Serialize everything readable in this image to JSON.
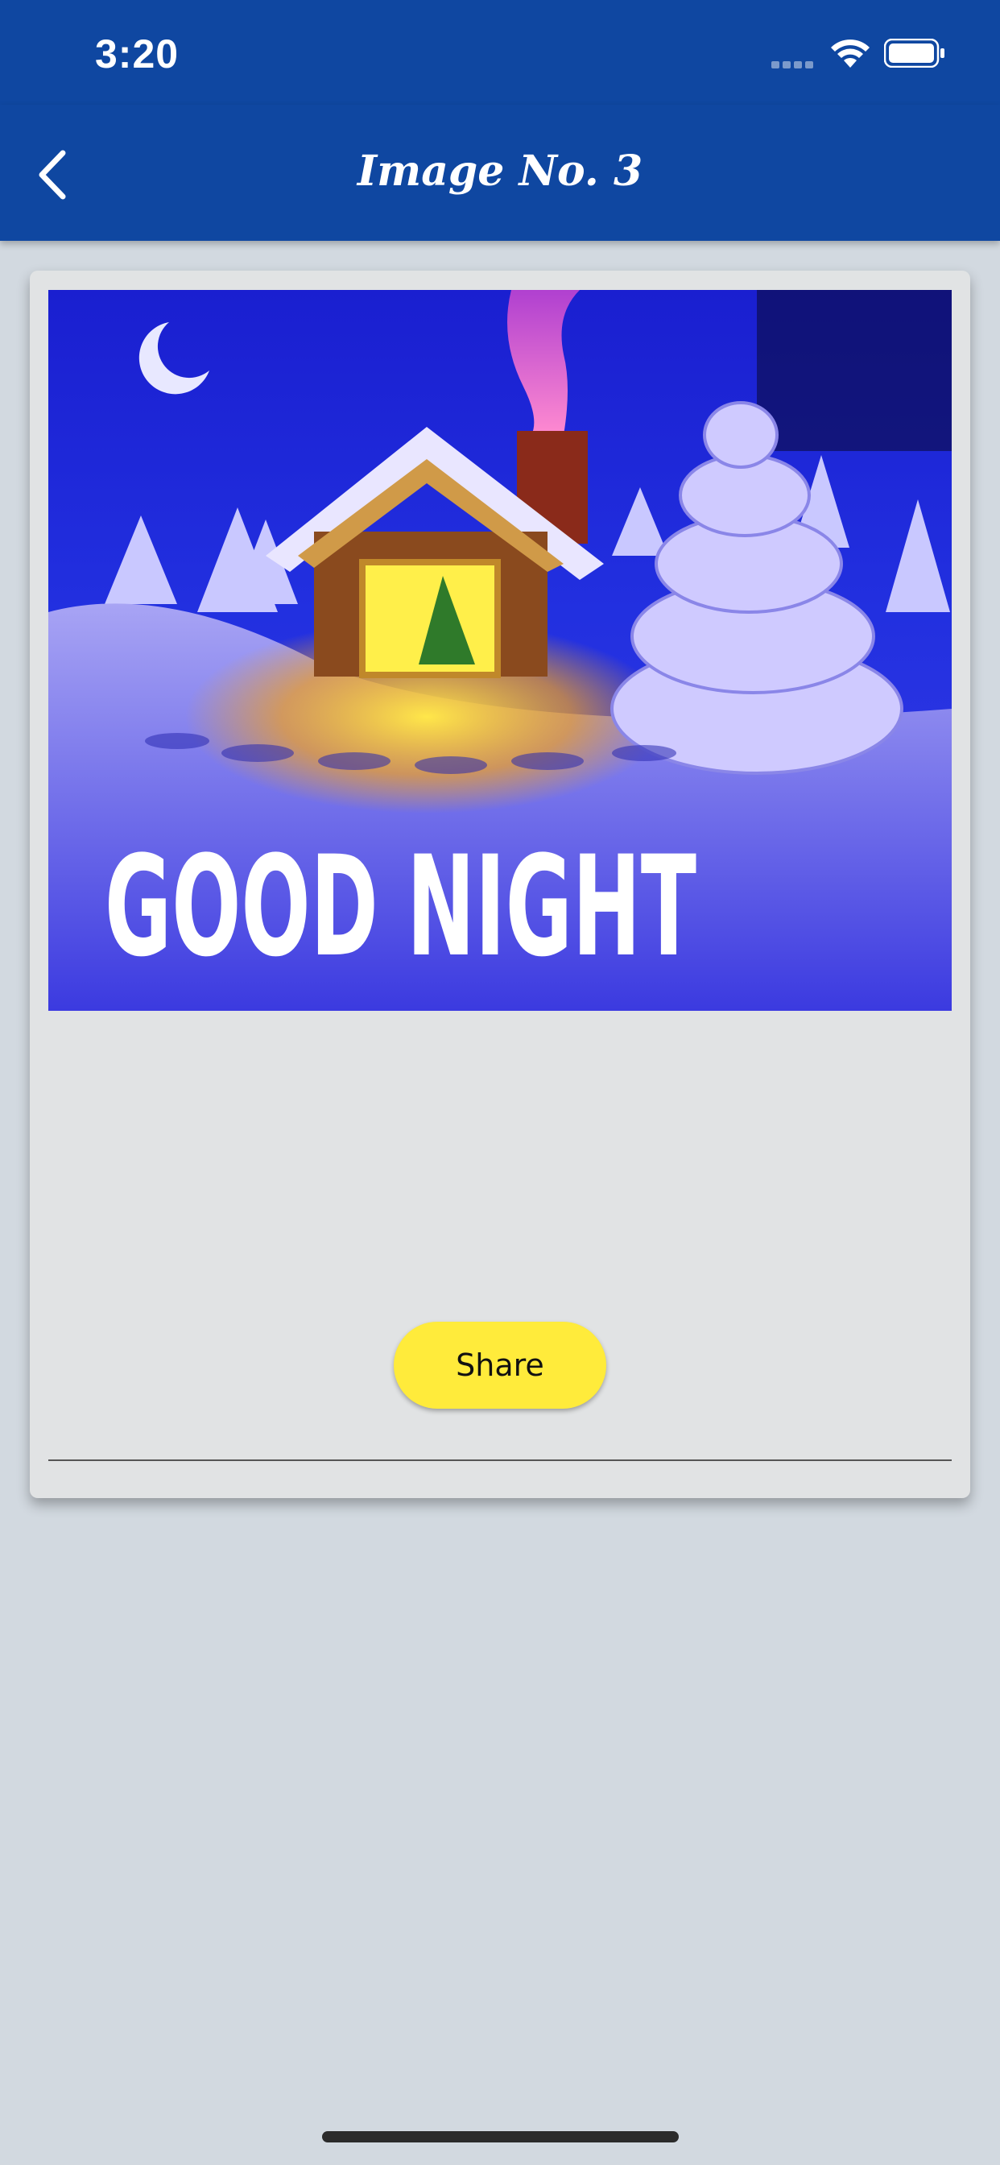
{
  "status_bar": {
    "time": "3:20",
    "signal_icon": "cellular-signal-icon",
    "wifi_icon": "wifi-icon",
    "battery_icon": "battery-icon"
  },
  "nav": {
    "title": "Image No. 3",
    "back_icon": "chevron-left-icon",
    "background_color": "#0f47a1"
  },
  "card": {
    "image": {
      "description_icon": "winter-cabin-image",
      "overlay_text": "GOOD NIGHT"
    },
    "share_label": "Share",
    "share_color": "#ffeb3b"
  }
}
